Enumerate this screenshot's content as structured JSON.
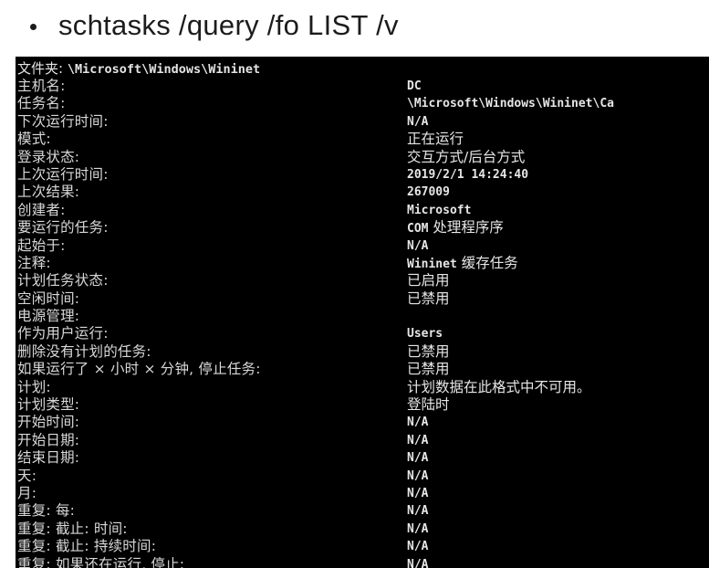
{
  "slide": {
    "command": "schtasks /query /fo LIST /v"
  },
  "console": {
    "folder_label": "文件夹:",
    "folder_path": "\\Microsoft\\Windows\\Wininet",
    "rows": [
      {
        "label": "主机名:",
        "value": "DC"
      },
      {
        "label": "任务名:",
        "value": "\\Microsoft\\Windows\\Wininet\\Ca"
      },
      {
        "label": "下次运行时间:",
        "value": "N/A"
      },
      {
        "label": "模式:",
        "value": "正在运行"
      },
      {
        "label": "登录状态:",
        "value": "交互方式/后台方式"
      },
      {
        "label": "上次运行时间:",
        "value": "2019/2/1 14:24:40"
      },
      {
        "label": "上次结果:",
        "value": "267009"
      },
      {
        "label": "创建者:",
        "value": "Microsoft"
      },
      {
        "label": "要运行的任务:",
        "value_mono": "COM",
        "value_text": " 处理程序序"
      },
      {
        "label": "起始于:",
        "value": "N/A"
      },
      {
        "label": "注释:",
        "value_mono": "Wininet",
        "value_text": " 缓存任务"
      },
      {
        "label": "计划任务状态:",
        "value": "已启用"
      },
      {
        "label": "空闲时间:",
        "value": "已禁用"
      },
      {
        "label": "电源管理:",
        "value": ""
      },
      {
        "label": "作为用户运行:",
        "value": "Users"
      },
      {
        "label": "删除没有计划的任务:",
        "value": "已禁用"
      },
      {
        "label": "如果运行了 × 小时 × 分钟, 停止任务:",
        "value": "已禁用"
      },
      {
        "label": "计划:",
        "value": "计划数据在此格式中不可用。"
      },
      {
        "label": "计划类型:",
        "value": "登陆时"
      },
      {
        "label": "开始时间:",
        "value": "N/A"
      },
      {
        "label": "开始日期:",
        "value": "N/A"
      },
      {
        "label": "结束日期:",
        "value": "N/A"
      },
      {
        "label": "天:",
        "value": "N/A"
      },
      {
        "label": "月:",
        "value": "N/A"
      },
      {
        "label": "重复: 每:",
        "value": "N/A"
      },
      {
        "label": "重复: 截止: 时间:",
        "value": "N/A"
      },
      {
        "label": "重复: 截止: 持续时间:",
        "value": "N/A"
      },
      {
        "label": "重复: 如果还在运行, 停止:",
        "value": "N/A"
      }
    ]
  }
}
